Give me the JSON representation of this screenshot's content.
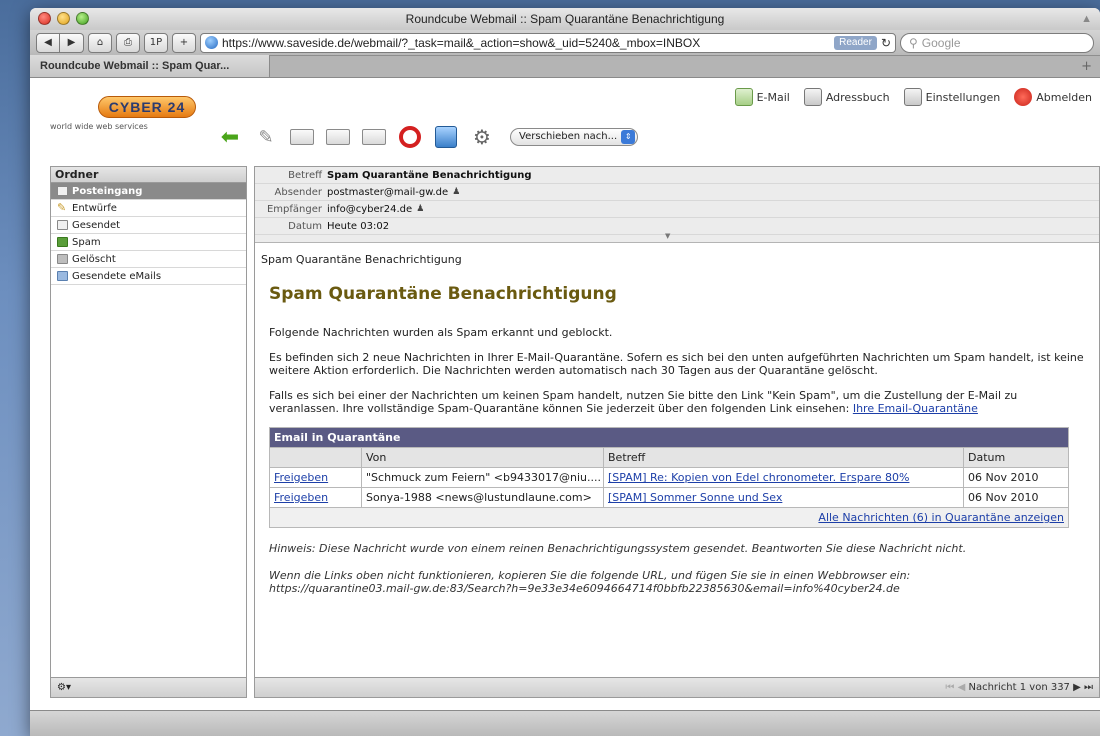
{
  "window": {
    "title": "Roundcube Webmail :: Spam Quarantäne Benachrichtigung"
  },
  "browser": {
    "url": "https://www.saveside.de/webmail/?_task=mail&_action=show&_uid=5240&_mbox=INBOX",
    "reader_label": "Reader",
    "search_placeholder": "Google",
    "tab_label": "Roundcube Webmail :: Spam Quar...",
    "btn_1p": "1P"
  },
  "brand": {
    "logo_text": "CYBER 24",
    "tagline": "world wide web services"
  },
  "topnav": {
    "email": "E-Mail",
    "addressbook": "Adressbuch",
    "settings": "Einstellungen",
    "logout": "Abmelden"
  },
  "toolbar": {
    "move_label": "Verschieben nach..."
  },
  "folders": {
    "header": "Ordner",
    "items": [
      {
        "label": "Posteingang"
      },
      {
        "label": "Entwürfe"
      },
      {
        "label": "Gesendet"
      },
      {
        "label": "Spam"
      },
      {
        "label": "Gelöscht"
      },
      {
        "label": "Gesendete eMails"
      }
    ]
  },
  "header": {
    "subject_key": "Betreff",
    "subject": "Spam Quarantäne Benachrichtigung",
    "from_key": "Absender",
    "from": "postmaster@mail-gw.de",
    "to_key": "Empfänger",
    "to": "info@cyber24.de",
    "date_key": "Datum",
    "date": "Heute 03:02"
  },
  "message": {
    "plain_subject": "Spam Quarantäne Benachrichtigung",
    "title": "Spam Quarantäne Benachrichtigung",
    "p1": "Folgende Nachrichten wurden als Spam erkannt und geblockt.",
    "p2": "Es befinden sich 2 neue Nachrichten in Ihrer E-Mail-Quarantäne. Sofern es sich bei den unten aufgeführten Nachrichten um Spam handelt, ist keine weitere Aktion erforderlich. Die Nachrichten werden automatisch nach 30 Tagen aus der Quarantäne gelöscht.",
    "p3": "Falls es sich bei einer der Nachrichten um keinen Spam handelt, nutzen Sie bitte den Link \"Kein Spam\", um die Zustellung der E-Mail zu veranlassen. Ihre vollständige Spam-Quarantäne können Sie jederzeit über den folgenden Link einsehen:",
    "p3_link": "Ihre Email-Quarantäne",
    "table": {
      "title": "Email in Quarantäne",
      "col_von": "Von",
      "col_betreff": "Betreff",
      "col_datum": "Datum",
      "rows": [
        {
          "action": "Freigeben",
          "from": "\"Schmuck zum Feiern\" <b9433017@niu....",
          "subject": "[SPAM] Re: Kopien von Edel chronometer. Erspare 80%",
          "date": "06 Nov 2010"
        },
        {
          "action": "Freigeben",
          "from": "Sonya-1988 <news@lustundlaune.com>",
          "subject": "[SPAM] Sommer Sonne und Sex",
          "date": "06 Nov 2010"
        }
      ],
      "show_all": "Alle Nachrichten (6) in Quarantäne anzeigen"
    },
    "note1": "Hinweis: Diese Nachricht wurde von einem reinen Benachrichtigungssystem gesendet. Beantworten Sie diese Nachricht nicht.",
    "note2": "Wenn die Links oben nicht funktionieren, kopieren Sie die folgende URL, und fügen Sie sie in einen Webbrowser ein:",
    "note3": "https://quarantine03.mail-gw.de:83/Search?h=9e33e34e6094664714f0bbfb22385630&email=info%40cyber24.de"
  },
  "pager": {
    "text": "Nachricht 1 von 337"
  }
}
